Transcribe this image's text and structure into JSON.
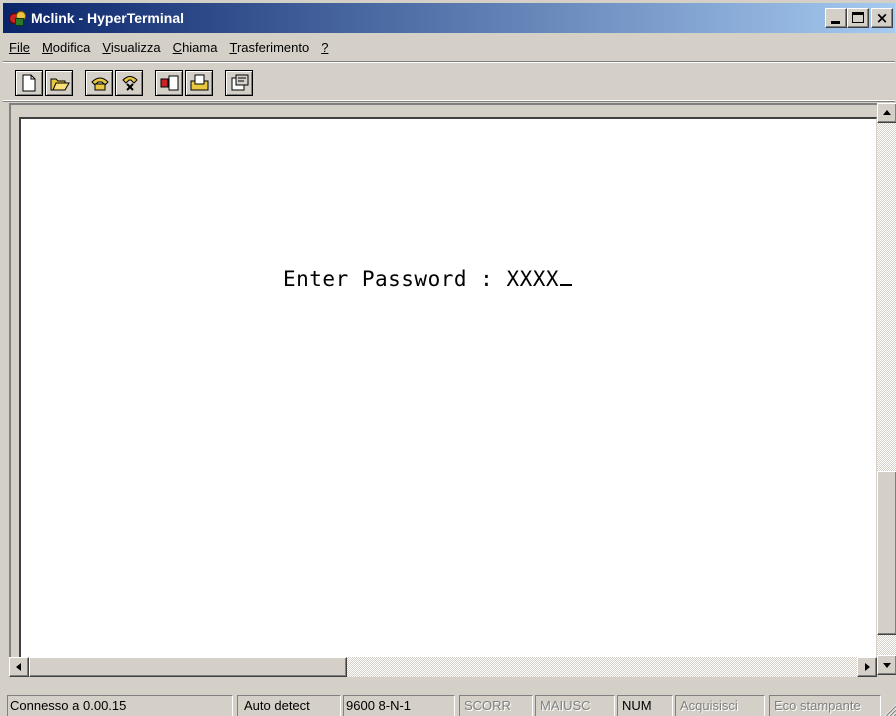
{
  "window": {
    "title": "Mclink - HyperTerminal"
  },
  "menu": [
    {
      "label": "File",
      "underline_index": 0
    },
    {
      "label": "Modifica",
      "underline_index": 0
    },
    {
      "label": "Visualizza",
      "underline_index": 0
    },
    {
      "label": "Chiama",
      "underline_index": 0
    },
    {
      "label": "Trasferimento",
      "underline_index": 0
    },
    {
      "label": "?",
      "underline_index": 0
    }
  ],
  "toolbar": {
    "groups": [
      [
        "new-icon",
        "open-icon"
      ],
      [
        "connect-icon",
        "disconnect-icon"
      ],
      [
        "send-icon",
        "receive-icon"
      ],
      [
        "properties-icon"
      ]
    ]
  },
  "terminal": {
    "prompt": "Enter Password : ",
    "input": "XXXX"
  },
  "status": {
    "connection": "Connesso a 0.00.15",
    "detect": "Auto detect",
    "port_settings": "9600 8-N-1",
    "scroll": "SCORR",
    "caps": "MAIUSC",
    "num": "NUM",
    "capture": "Acquisisci",
    "print_echo": "Eco stampante"
  },
  "colors": {
    "title_start": "#0a246a",
    "title_end": "#a6caf0",
    "chrome": "#d4d0c8"
  }
}
